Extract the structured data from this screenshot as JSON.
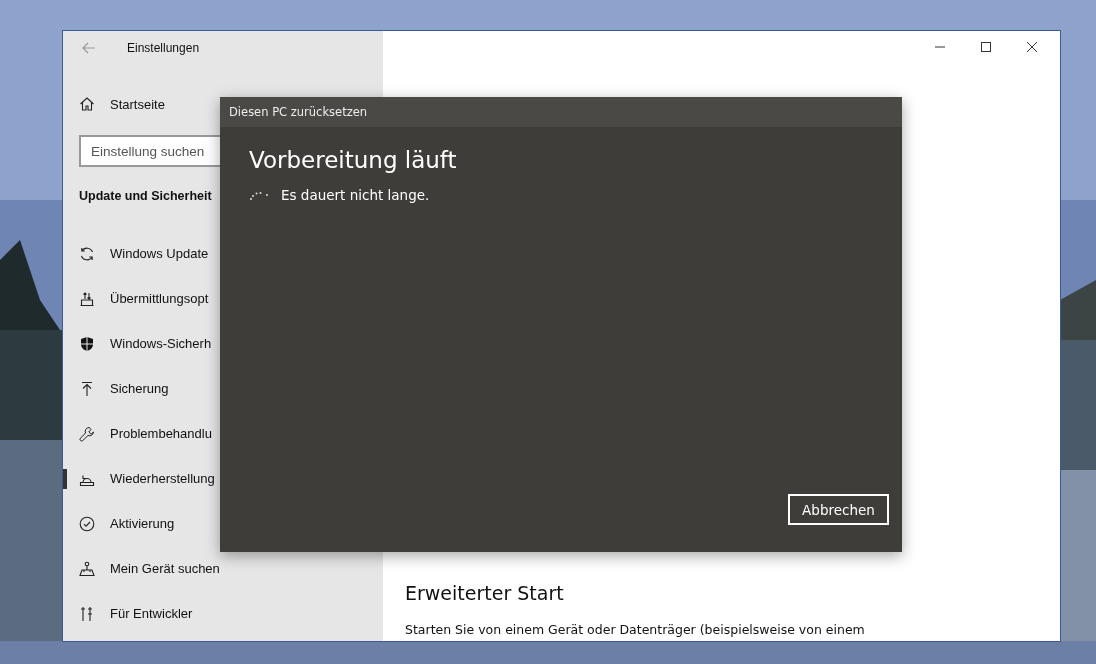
{
  "window": {
    "title": "Einstellungen"
  },
  "sidebar": {
    "home": "Startseite",
    "search": {
      "placeholder": "Einstellung suchen"
    },
    "section": "Update und Sicherheit",
    "items": [
      {
        "label": "Windows Update",
        "kind": "update",
        "selected": false
      },
      {
        "label": "Übermittlungsopt",
        "kind": "delivery",
        "selected": false
      },
      {
        "label": "Windows-Sicherh",
        "kind": "shield",
        "selected": false
      },
      {
        "label": "Sicherung",
        "kind": "backup",
        "selected": false
      },
      {
        "label": "Problembehandlu",
        "kind": "wrench",
        "selected": false
      },
      {
        "label": "Wiederherstellung",
        "kind": "recovery",
        "selected": true
      },
      {
        "label": "Aktivierung",
        "kind": "check",
        "selected": false
      },
      {
        "label": "Mein Gerät suchen",
        "kind": "find",
        "selected": false
      },
      {
        "label": "Für Entwickler",
        "kind": "dev",
        "selected": false
      }
    ]
  },
  "main": {
    "section_title": "Erweiterter Start",
    "section_text": "Starten Sie von einem Gerät oder Datenträger (beispielsweise von einem"
  },
  "dialog": {
    "title": "Diesen PC zurücksetzen",
    "heading": "Vorbereitung läuft",
    "status": "Es dauert nicht lange.",
    "buttons": [
      "Abbrechen"
    ]
  }
}
